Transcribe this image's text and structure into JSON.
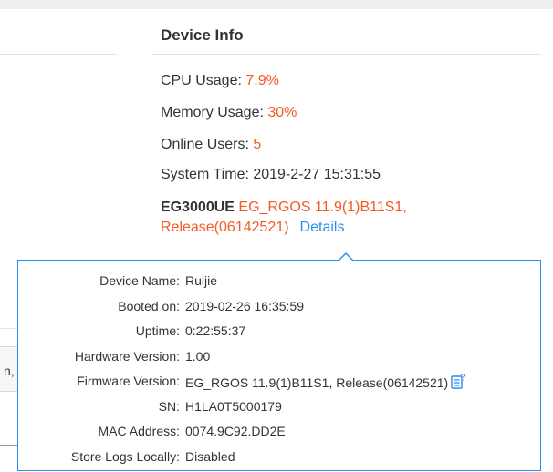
{
  "device_info": {
    "title": "Device Info",
    "cpu_label": "CPU Usage: ",
    "cpu_value": "7.9%",
    "memory_label": "Memory Usage: ",
    "memory_value": "30%",
    "online_users_label": "Online Users: ",
    "online_users_value": "5",
    "system_time_label": "System Time: ",
    "system_time_value": "2019-2-27 15:31:55",
    "model": "EG3000UE",
    "firmware_summary": "EG_RGOS 11.9(1)B11S1, Release(06142521)",
    "details_link": "Details"
  },
  "popup": {
    "rows": [
      {
        "label": "Device Name:",
        "value": "Ruijie"
      },
      {
        "label": "Booted on:",
        "value": "2019-02-26 16:35:59"
      },
      {
        "label": "Uptime:",
        "value": "0:22:55:37"
      },
      {
        "label": "Hardware Version:",
        "value": "1.00"
      },
      {
        "label": "Firmware Version:",
        "value": "EG_RGOS 11.9(1)B11S1, Release(06142521)"
      },
      {
        "label": "SN:",
        "value": "H1LA0T5000179"
      },
      {
        "label": "MAC Address:",
        "value": "0074.9C92.DD2E"
      },
      {
        "label": "Store Logs Locally:",
        "value": "Disabled"
      }
    ],
    "copy_icon": "copy-document-icon"
  },
  "background_fragments": {
    "left_text": "n,"
  },
  "colors": {
    "accent": "#f35a26",
    "link": "#2d8cf0",
    "text": "#333333",
    "border": "#2d8cf0"
  }
}
